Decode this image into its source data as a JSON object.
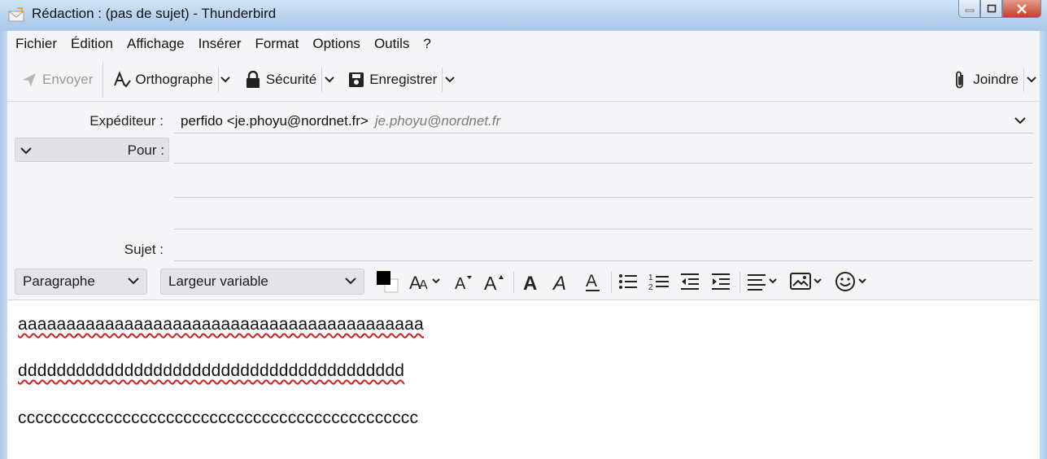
{
  "window": {
    "title": "Rédaction : (pas de sujet) - Thunderbird"
  },
  "menu": {
    "items": [
      {
        "label": "Fichier"
      },
      {
        "label": "Édition"
      },
      {
        "label": "Affichage"
      },
      {
        "label": "Insérer"
      },
      {
        "label": "Format"
      },
      {
        "label": "Options"
      },
      {
        "label": "Outils"
      },
      {
        "label": "?"
      }
    ]
  },
  "toolbar": {
    "send_label": "Envoyer",
    "spelling_label": "Orthographe",
    "security_label": "Sécurité",
    "save_label": "Enregistrer",
    "attach_label": "Joindre"
  },
  "headers": {
    "from_label": "Expéditeur :",
    "from_value": "perfido <je.phoyu@nordnet.fr>",
    "from_identity": "je.phoyu@nordnet.fr",
    "to_label": "Pour :",
    "subject_label": "Sujet :"
  },
  "format": {
    "paragraph_style": "Paragraphe",
    "font": "Largeur variable",
    "text_color": "#000000",
    "background_color": "#ffffff"
  },
  "body": {
    "lines": [
      "aaaaaaaaaaaaaaaaaaaaaaaaaaaaaaaaaaaaaaaaaa",
      "dddddddddddddddddddddddddddddddddddddddd",
      "cccccccccccccccccccccccccccccccccccccccccccccc"
    ]
  },
  "colors": {
    "titlebar": "#b9d3ee",
    "toolbar_bg": "#f5f5f7",
    "spellcheck_underline": "#d21f1f"
  }
}
